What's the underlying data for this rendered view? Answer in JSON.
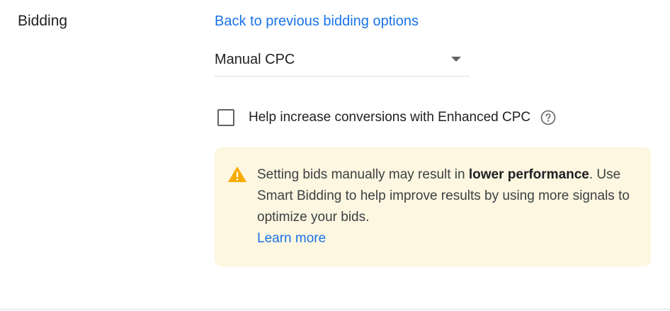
{
  "section": {
    "title": "Bidding"
  },
  "back_link": "Back to previous bidding options",
  "strategy_dropdown": {
    "value": "Manual CPC"
  },
  "enhanced_cpc": {
    "label": "Help increase conversions with Enhanced CPC",
    "checked": false
  },
  "notice": {
    "text_before": "Setting bids manually may result in ",
    "text_bold": "lower performance",
    "text_after": ". Use Smart Bidding to help improve results by using more signals to optimize your bids.",
    "learn_more": "Learn more"
  },
  "colors": {
    "link": "#1a73e8",
    "warning": "#f9ab00",
    "notice_bg": "#fdf6e0"
  },
  "icons": {
    "help": "help-circle-icon",
    "warning": "warning-triangle-icon",
    "dropdown": "caret-down-icon"
  }
}
